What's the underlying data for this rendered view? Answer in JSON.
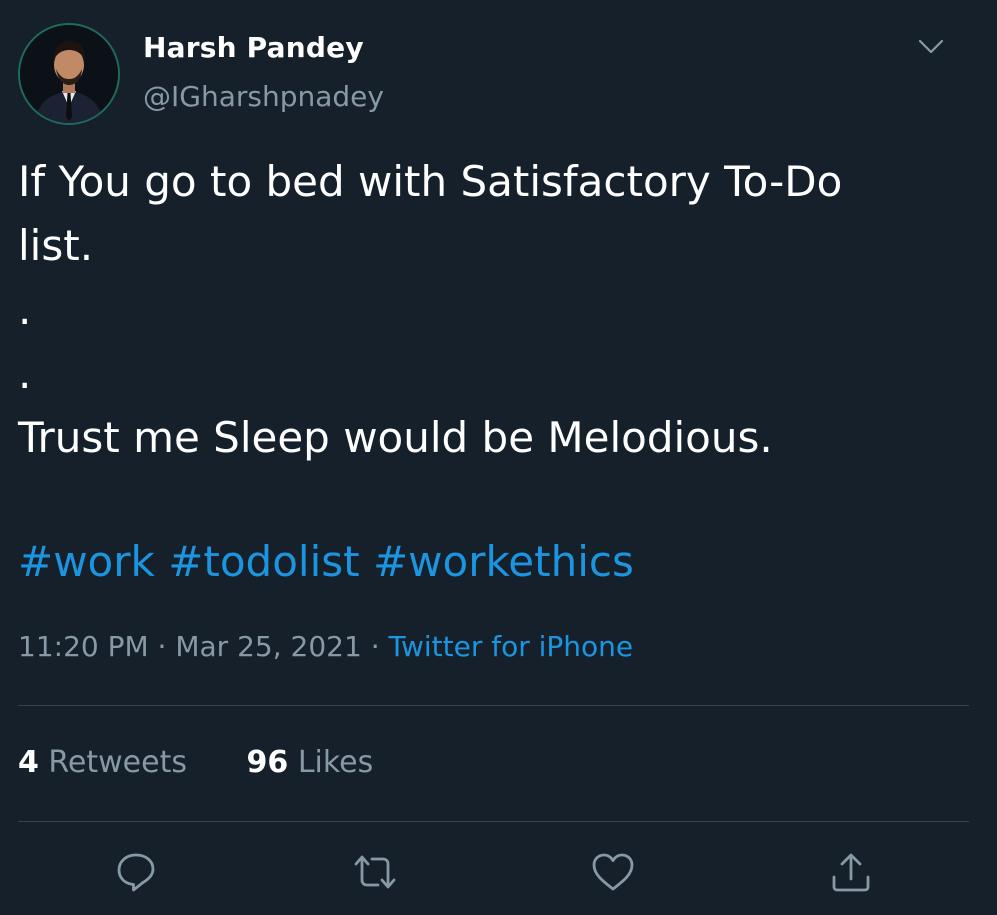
{
  "user": {
    "display_name": "Harsh Pandey",
    "handle": "@IGharshpnadey",
    "avatar_icon": "profile-photo"
  },
  "tweet": {
    "lines": [
      "If You go to bed with Satisfactory To-Do",
      "list.",
      ".",
      ".",
      "Trust me Sleep would be Melodious."
    ],
    "hashtags": [
      "#work",
      "#todolist",
      "#workethics"
    ],
    "time": "11:20 PM",
    "separator": "·",
    "date": "Mar 25, 2021",
    "source": "Twitter for iPhone"
  },
  "stats": {
    "retweets_count": "4",
    "retweets_label": "Retweets",
    "likes_count": "96",
    "likes_label": "Likes"
  },
  "actions": {
    "reply_icon": "reply-icon",
    "retweet_icon": "retweet-icon",
    "like_icon": "heart-icon",
    "share_icon": "share-icon"
  },
  "colors": {
    "background": "#15202b",
    "text": "#ffffff",
    "muted": "#8899a6",
    "link": "#1b95e0",
    "divider": "#38444d"
  }
}
